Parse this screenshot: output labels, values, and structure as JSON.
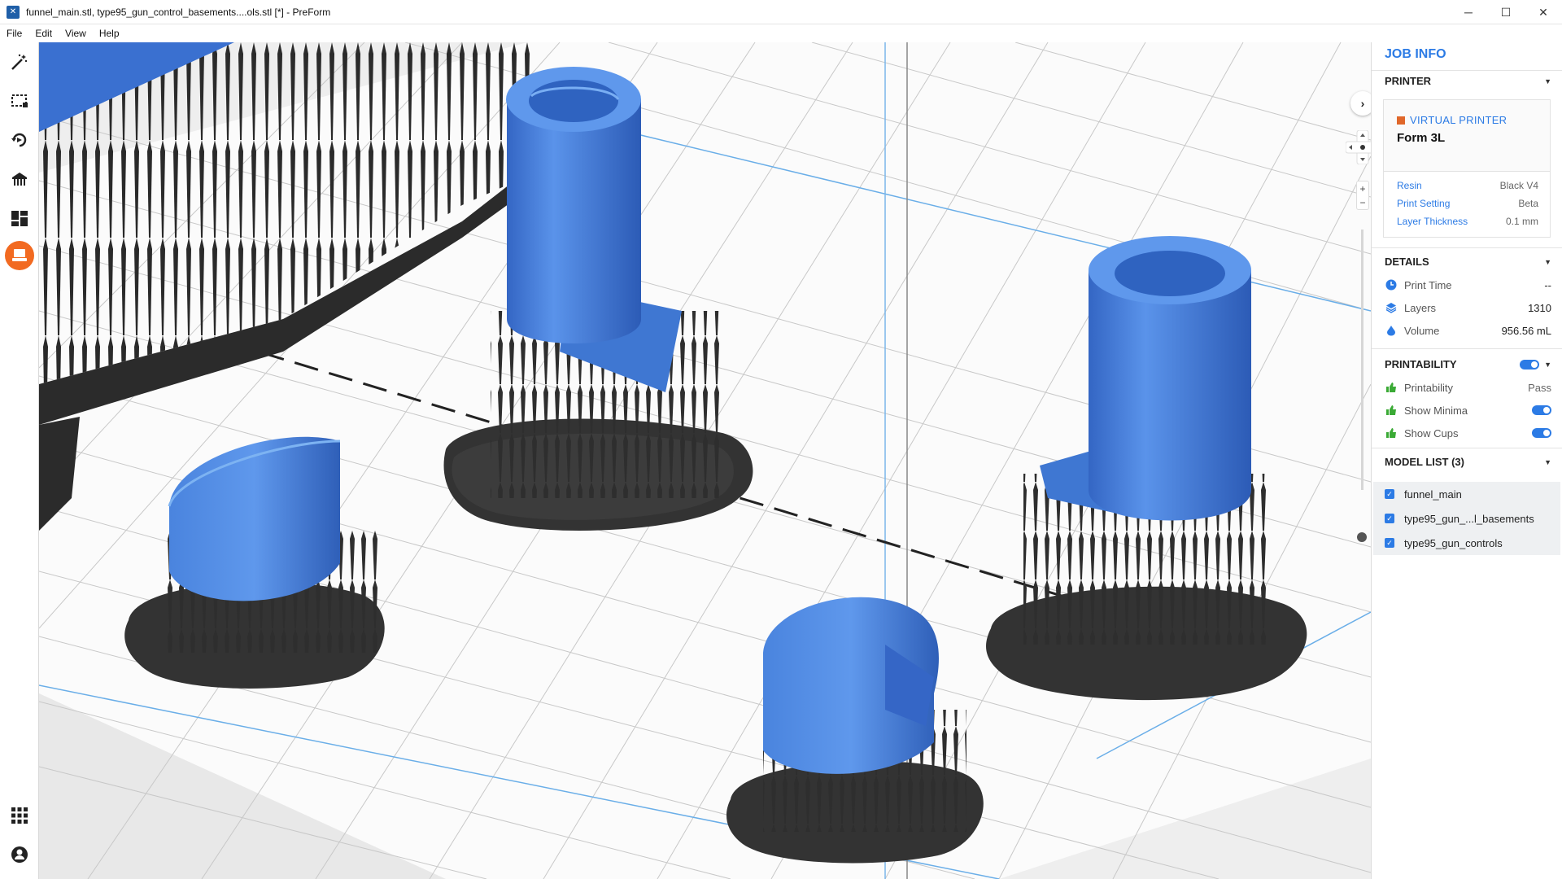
{
  "window": {
    "title": "funnel_main.stl, type95_gun_control_basements....ols.stl [*] - PreForm",
    "minimize": "─",
    "maximize": "☐",
    "close": "✕"
  },
  "menu": [
    "File",
    "Edit",
    "View",
    "Help"
  ],
  "toolbar": {
    "tools": [
      "magic-wand-icon",
      "select-icon",
      "orientation-icon",
      "supports-icon",
      "layout-icon",
      "print-icon"
    ],
    "bottom": [
      "apps-grid-icon",
      "account-icon"
    ]
  },
  "panel": {
    "title": "JOB INFO",
    "printer": {
      "header": "PRINTER",
      "label": "VIRTUAL PRINTER",
      "name": "Form 3L",
      "specs": [
        {
          "k": "Resin",
          "v": "Black V4"
        },
        {
          "k": "Print Setting",
          "v": "Beta"
        },
        {
          "k": "Layer Thickness",
          "v": "0.1 mm"
        }
      ]
    },
    "details": {
      "header": "DETAILS",
      "rows": [
        {
          "k": "Print Time",
          "v": "--"
        },
        {
          "k": "Layers",
          "v": "1310"
        },
        {
          "k": "Volume",
          "v": "956.56 mL"
        }
      ]
    },
    "printability": {
      "header": "PRINTABILITY",
      "rows": [
        {
          "k": "Printability",
          "v": "Pass"
        },
        {
          "k": "Show Minima",
          "v": ""
        },
        {
          "k": "Show Cups",
          "v": ""
        }
      ]
    },
    "models": {
      "header": "MODEL LIST (3)",
      "items": [
        "funnel_main",
        "type95_gun_...l_basements",
        "type95_gun_controls"
      ]
    }
  },
  "colors": {
    "accent": "#2c7be5",
    "active_tool": "#f26a21",
    "model_blue": "#3f7fd8",
    "support": "#3a3a3a"
  }
}
